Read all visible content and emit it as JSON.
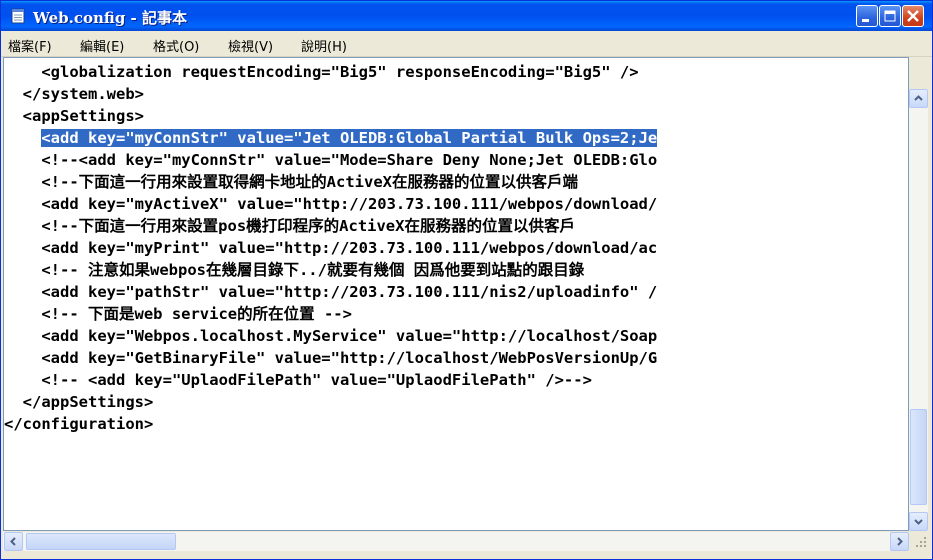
{
  "window": {
    "title": "Web.config - 記事本"
  },
  "menu": {
    "file": "檔案(F)",
    "edit": "編輯(E)",
    "format": "格式(O)",
    "view": "檢視(V)",
    "help": "說明(H)"
  },
  "editor": {
    "selected_line_index": 3,
    "lines": [
      "    <globalization requestEncoding=\"Big5\" responseEncoding=\"Big5\" />",
      "  </system.web>",
      "  <appSettings>",
      "    <add key=\"myConnStr\" value=\"Jet OLEDB:Global Partial Bulk Ops=2;Je",
      "    <!--<add key=\"myConnStr\" value=\"Mode=Share Deny None;Jet OLEDB:Glo",
      "    <!--下面這一行用來設置取得網卡地址的ActiveX在服務器的位置以供客戶端",
      "    <add key=\"myActiveX\" value=\"http://203.73.100.111/webpos/download/",
      "    <!--下面這一行用來設置pos機打印程序的ActiveX在服務器的位置以供客戶",
      "    <add key=\"myPrint\" value=\"http://203.73.100.111/webpos/download/ac",
      "    <!-- 注意如果webpos在幾層目錄下../就要有幾個 因爲他要到站點的跟目錄",
      "    <add key=\"pathStr\" value=\"http://203.73.100.111/nis2/uploadinfo\" /",
      "    <!-- 下面是web service的所在位置 -->",
      "    <add key=\"Webpos.localhost.MyService\" value=\"http://localhost/Soap",
      "    <add key=\"GetBinaryFile\" value=\"http://localhost/WebPosVersionUp/G",
      "    <!-- <add key=\"UplaodFilePath\" value=\"UplaodFilePath\" />-->",
      "  </appSettings>",
      "</configuration>"
    ]
  },
  "icons": {
    "app": "notepad-icon",
    "minimize": "minimize-icon",
    "maximize": "maximize-icon",
    "close": "close-icon"
  },
  "colors": {
    "titlebar": "#0054e3",
    "selection": "#316ac5",
    "close_button": "#d0421e"
  }
}
